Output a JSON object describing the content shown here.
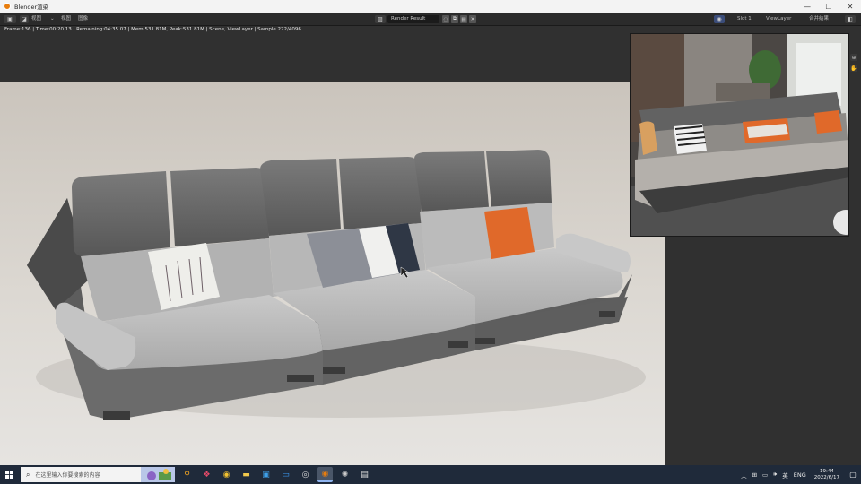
{
  "window": {
    "title": "Blender渲染",
    "controls": {
      "minimize": "—",
      "maximize": "☐",
      "close": "✕"
    }
  },
  "header": {
    "menu_view": "视图",
    "menu_image": "图像",
    "menu_view2": "视图",
    "render_slot_name": "Render Result",
    "slot": "Slot 1",
    "view_layer": "ViewLayer",
    "pass": "合并结果"
  },
  "render_info": "Frame:136 | Time:00:20.13 | Remaining:04:35.07 | Mem:531.81M, Peak:531.81M | Scene, ViewLayer | Sample 272/4096",
  "taskbar": {
    "search_placeholder": "在这里输入你要搜索的内容",
    "language": "ENG",
    "time": "19:44",
    "date": "2022/6/17"
  },
  "colors": {
    "blender_orange": "#e87d0d",
    "taskbar_bg": "#1f2a3a",
    "sofa_dark": "#6a6a6a",
    "sofa_light": "#b5b5b5",
    "pillow_orange": "#e0692a"
  }
}
